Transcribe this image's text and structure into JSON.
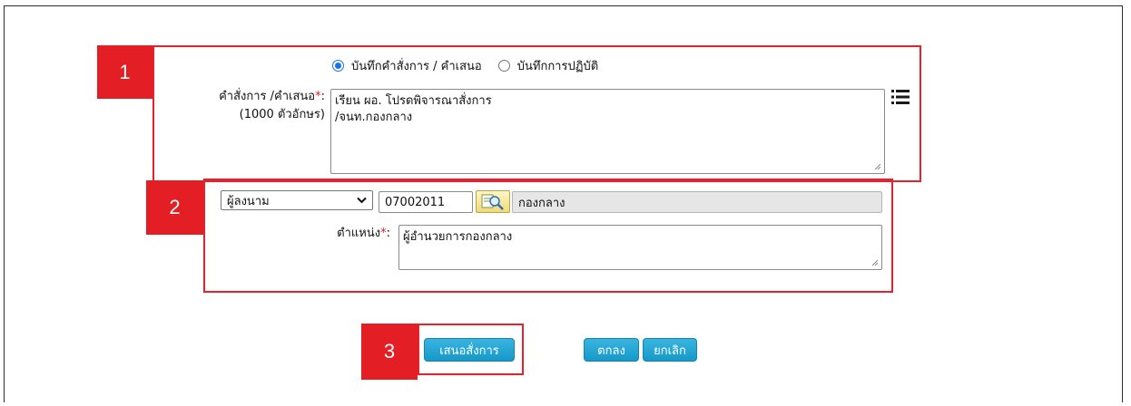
{
  "top_mark": "ุ",
  "badges": [
    "1",
    "2",
    "3"
  ],
  "mode": {
    "option_1": "บันทึกคำสั่งการ / คำเสนอ",
    "option_2": "บันทึกการปฏิบัติ",
    "selected": "option_1"
  },
  "order": {
    "label": "คำสั่งการ /คำเสนอ",
    "required_mark": "*",
    "colon": ":",
    "limit": "(1000 ตัวอักษร)",
    "text": "เรียน ผอ. โปรดพิจารณาสั่งการ\n/จนท.กองกลาง"
  },
  "signer": {
    "select_value": "ผู้ลงนาม",
    "code": "07002011",
    "lookup_icon": "magnifier-lookup-icon",
    "department": "กองกลาง"
  },
  "position": {
    "label": "ตำแหน่ง",
    "required_mark": "*",
    "colon": ":",
    "value": "ผู้อำนวยการกองกลาง"
  },
  "buttons": {
    "propose": "เสนอสั่งการ",
    "ok": "ตกลง",
    "cancel": "ยกเลิก"
  },
  "colors": {
    "highlight_red": "#e31e24",
    "button_blue": "#1699c9",
    "radio_blue": "#1a73e8"
  }
}
